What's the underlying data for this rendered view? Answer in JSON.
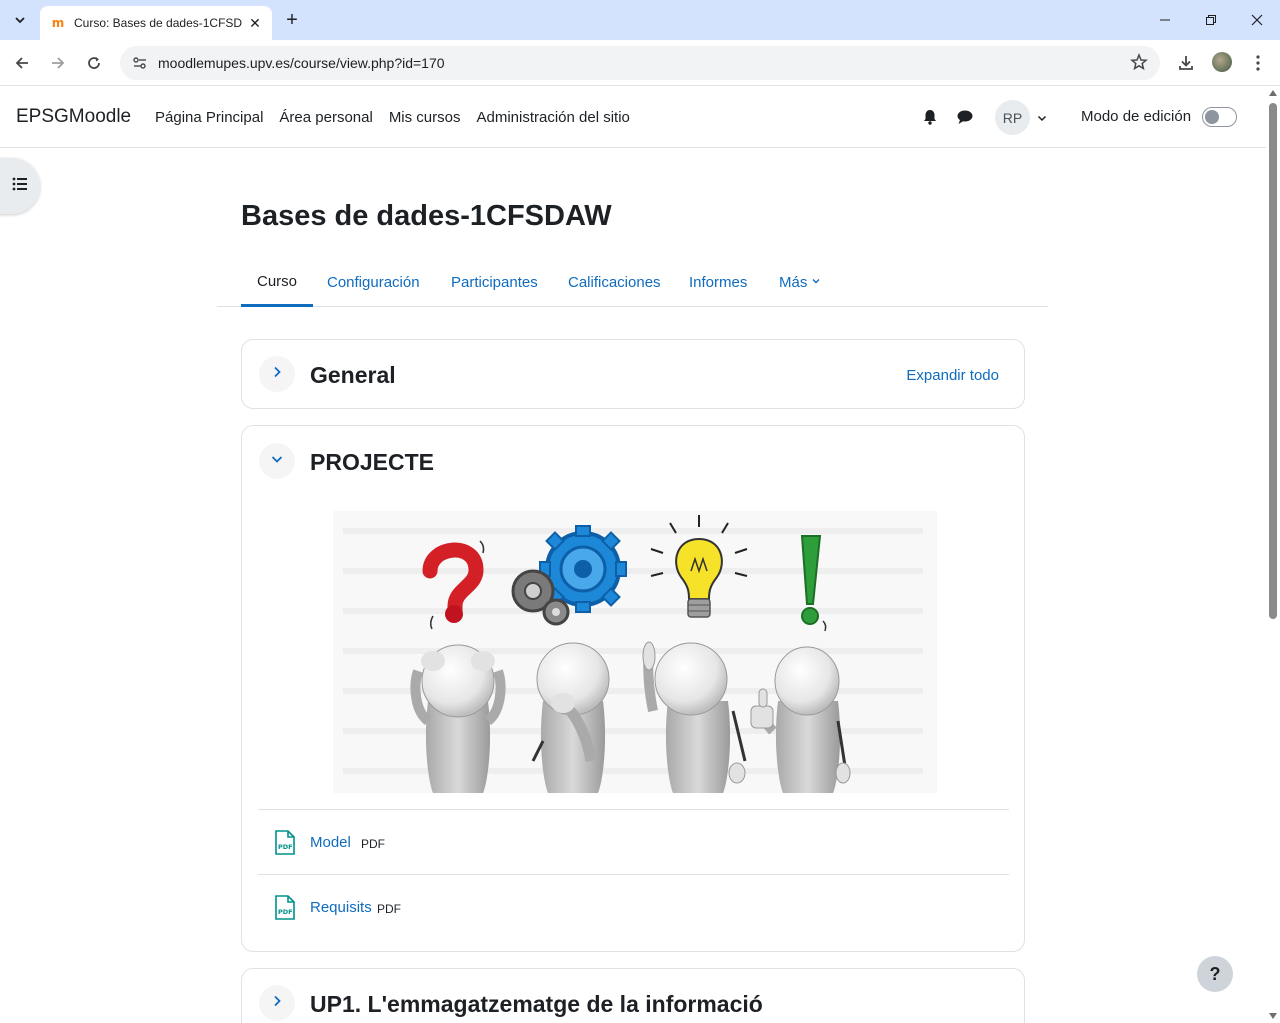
{
  "browser": {
    "tab_title": "Curso: Bases de dades-1CFSDAW",
    "url": "moodlemupes.upv.es/course/view.php?id=170",
    "icons": [
      "tab-search-icon",
      "moodle-favicon",
      "close-icon",
      "plus-icon",
      "minimize-icon",
      "restore-icon",
      "close-window-icon",
      "back-icon",
      "forward-icon",
      "reload-icon",
      "site-info-icon",
      "star-icon",
      "download-icon",
      "kebab-menu-icon"
    ]
  },
  "navbar": {
    "brand": "EPSGMoodle",
    "items": [
      {
        "label": "Página Principal"
      },
      {
        "label": "Área personal"
      },
      {
        "label": "Mis cursos"
      },
      {
        "label": "Administración del sitio"
      }
    ],
    "user_initials": "RP",
    "edit_mode_label": "Modo de edición",
    "edit_mode_on": false
  },
  "course": {
    "title": "Bases de dades-1CFSDAW",
    "tabs": [
      {
        "label": "Curso",
        "active": true
      },
      {
        "label": "Configuración"
      },
      {
        "label": "Participantes"
      },
      {
        "label": "Calificaciones"
      },
      {
        "label": "Informes"
      },
      {
        "label": "Más"
      }
    ]
  },
  "sections": [
    {
      "title": "General",
      "expanded": false,
      "action": "Expandir todo"
    },
    {
      "title": "PROJECTE",
      "expanded": true,
      "activities": [
        {
          "name": "Model",
          "type": "PDF"
        },
        {
          "name": "Requisits",
          "type": "PDF"
        }
      ]
    },
    {
      "title": "UP1. L'emmagatzematge de la informació",
      "expanded": false
    }
  ],
  "help": {
    "label": "?"
  },
  "colors": {
    "link": "#0f6cbf",
    "text": "#1d2125",
    "tabbar": "#d3e3fd",
    "pdf": "#00938c"
  }
}
